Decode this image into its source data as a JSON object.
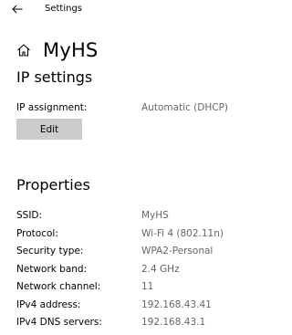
{
  "window": {
    "app_title": "Settings"
  },
  "header": {
    "page_title": "MyHS"
  },
  "ip_settings": {
    "title": "IP settings",
    "assignment_label": "IP assignment:",
    "assignment_value": "Automatic (DHCP)",
    "edit_label": "Edit"
  },
  "properties": {
    "title": "Properties",
    "rows": [
      {
        "label": "SSID:",
        "value": "MyHS"
      },
      {
        "label": "Protocol:",
        "value": "Wi-Fi 4 (802.11n)"
      },
      {
        "label": "Security type:",
        "value": "WPA2-Personal"
      },
      {
        "label": "Network band:",
        "value": "2.4 GHz"
      },
      {
        "label": "Network channel:",
        "value": "11"
      },
      {
        "label": "IPv4 address:",
        "value": "192.168.43.41"
      },
      {
        "label": "IPv4 DNS servers:",
        "value": "192.168.43.1"
      }
    ]
  },
  "icons": {
    "back": "back-arrow-icon",
    "home": "home-icon"
  }
}
